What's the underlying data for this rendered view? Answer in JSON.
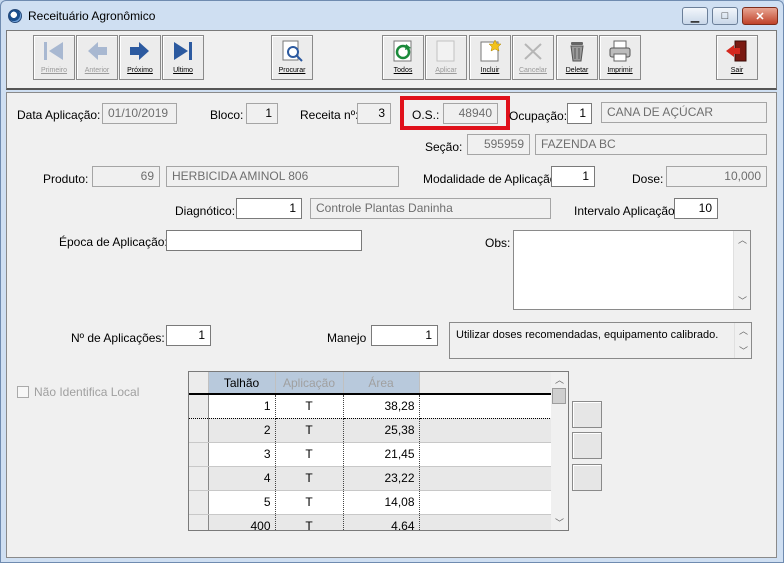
{
  "window": {
    "title": "Receituário Agronômico",
    "minimize": "▁",
    "maximize": "□",
    "close": "✕"
  },
  "toolbar": {
    "primeiro": "Primeiro",
    "anterior": "Anterior",
    "proximo": "Próximo",
    "ultimo": "Ultimo",
    "procurar": "Procurar",
    "todos": "Todos",
    "aplicar": "Aplicar",
    "incluir": "Incluir",
    "cancelar": "Cancelar",
    "deletar": "Deletar",
    "imprimir": "Imprimir",
    "sair": "Sair"
  },
  "form": {
    "data_aplicacao_label": "Data Aplicação:",
    "data_aplicacao": "01/10/2019",
    "bloco_label": "Bloco:",
    "bloco": "1",
    "receita_label": "Receita nº:",
    "receita": "3",
    "os_label": "O.S.:",
    "os": "48940",
    "ocupacao_label": "Ocupação:",
    "ocupacao_code": "1",
    "ocupacao_name": "CANA DE AÇÚCAR",
    "secao_label": "Seção:",
    "secao_code": "595959",
    "secao_name": "FAZENDA BC",
    "produto_label": "Produto:",
    "produto_code": "69",
    "produto_name": "HERBICIDA AMINOL 806",
    "modalidade_label": "Modalidade de Aplicação:",
    "modalidade": "1",
    "dose_label": "Dose:",
    "dose": "10,000",
    "diagnostico_label": "Diagnótico:",
    "diagnostico_code": "1",
    "diagnostico_name": "Controle Plantas Daninha",
    "intervalo_label": "Intervalo Aplicação:",
    "intervalo": "10",
    "epoca_label": "Época de Aplicação:",
    "epoca": "",
    "obs_label": "Obs:",
    "obs": "",
    "n_aplicacoes_label": "Nº de Aplicações:",
    "n_aplicacoes": "1",
    "manejo_label": "Manejo",
    "manejo_code": "1",
    "manejo_text": "Utilizar doses recomendadas, equipamento calibrado.",
    "nao_identifica_label": "Não Identifica Local"
  },
  "grid": {
    "columns": [
      "Talhão",
      "Aplicação",
      "Área"
    ],
    "rows": [
      [
        "1",
        "T",
        "38,28"
      ],
      [
        "2",
        "T",
        "25,38"
      ],
      [
        "3",
        "T",
        "21,45"
      ],
      [
        "4",
        "T",
        "23,22"
      ],
      [
        "5",
        "T",
        "14,08"
      ],
      [
        "400",
        "T",
        "4,64"
      ]
    ]
  },
  "colors": {
    "highlight": "#e0111b",
    "grid_header": "#b8c9dc"
  }
}
